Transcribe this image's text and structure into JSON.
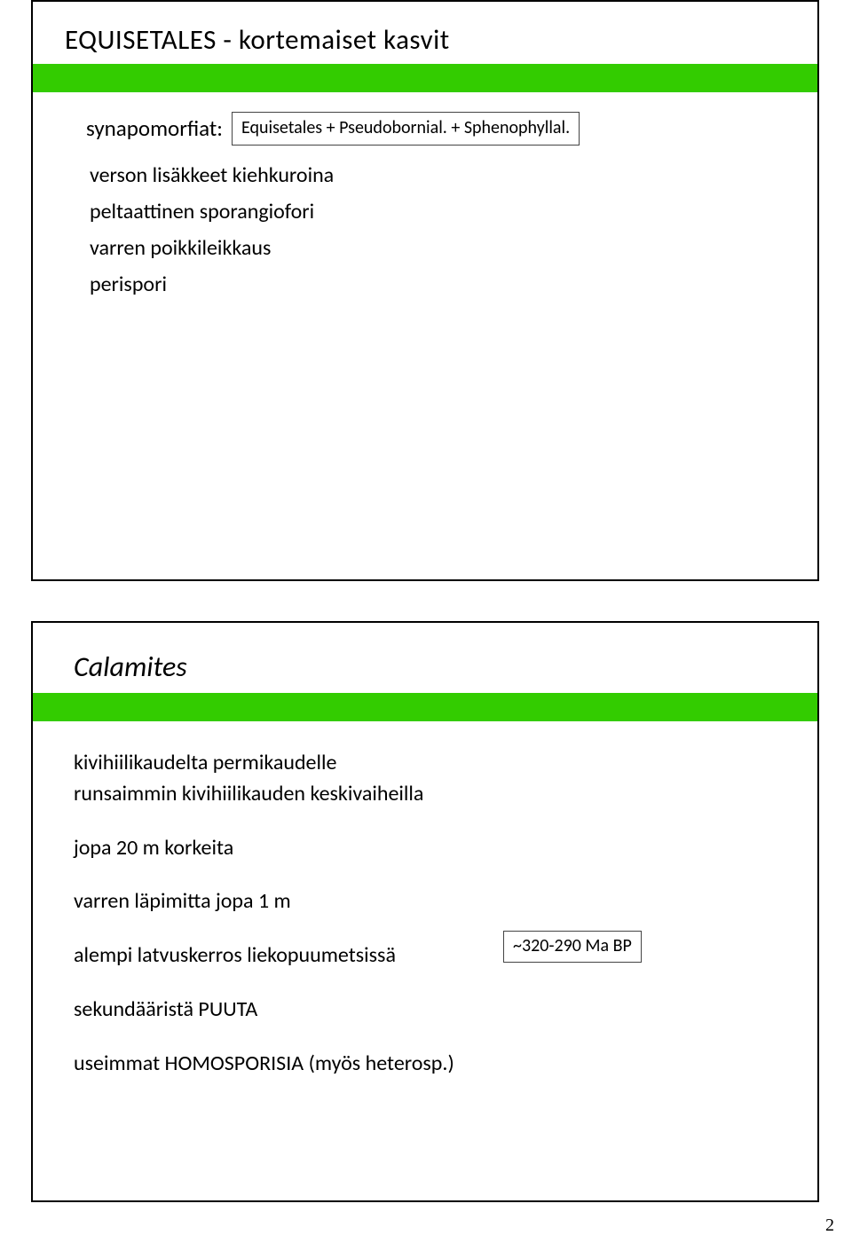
{
  "slide1": {
    "title": "EQUISETALES - kortemaiset kasvit",
    "synapomorfiat_label": "synapomorfiat:",
    "synapomorfiat_box": "Equisetales + Pseudobornial. + Sphenophyllal.",
    "lines": {
      "l1": "verson lisäkkeet kiehkuroina",
      "l2": "peltaattinen sporangiofori",
      "l3": "varren poikkileikkaus",
      "l4": "perispori"
    }
  },
  "slide2": {
    "title": "Calamites",
    "lines": {
      "l1": "kivihiilikaudelta permikaudelle",
      "l2": "runsaimmin kivihiilikauden keskivaiheilla",
      "l3": "jopa 20 m korkeita",
      "l4": "varren läpimitta jopa 1 m",
      "l5": "alempi latvuskerros liekopuumetsissä",
      "l6": "sekundääristä PUUTA",
      "l7": "useimmat HOMOSPORISIA (myös heterosp.)"
    },
    "annotation": "~320-290 Ma BP"
  },
  "page_number": "2"
}
